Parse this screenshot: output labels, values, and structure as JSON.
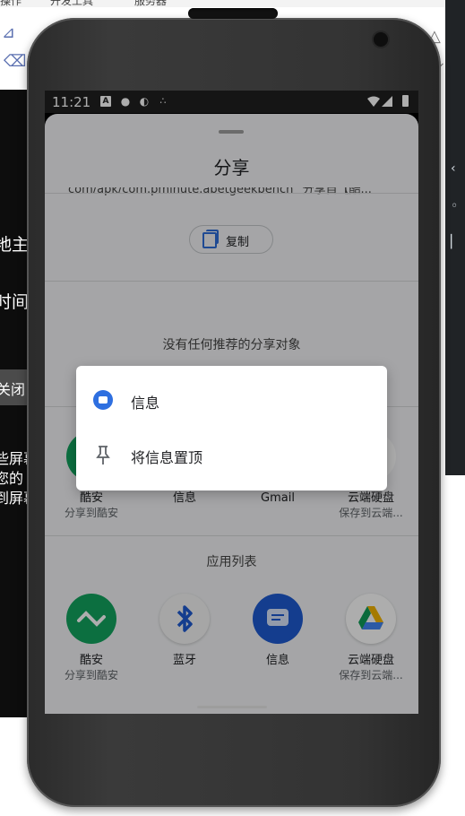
{
  "status_bar": {
    "time": "11:21"
  },
  "sheet": {
    "title": "分享",
    "share_text": "com/apk/com.pminute.abetgeekbench\" 分享自【酷...",
    "copy_label": "复制",
    "no_recommend": "没有任何推荐的分享对象",
    "app_list_title": "应用列表",
    "direct_targets": [
      {
        "name": "酷安",
        "sub": "分享到酷安",
        "icon": "coolapk-icon"
      },
      {
        "name": "信息",
        "sub": "",
        "icon": "messages-icon"
      },
      {
        "name": "Gmail",
        "sub": "",
        "icon": "gmail-icon"
      },
      {
        "name": "云端硬盘",
        "sub": "保存到云端...",
        "icon": "drive-icon"
      }
    ],
    "apps": [
      {
        "name": "酷安",
        "sub": "分享到酷安",
        "icon": "coolapk-icon"
      },
      {
        "name": "蓝牙",
        "sub": "",
        "icon": "bluetooth-icon"
      },
      {
        "name": "信息",
        "sub": "",
        "icon": "messages-icon"
      },
      {
        "name": "云端硬盘",
        "sub": "保存到云端...",
        "icon": "drive-icon"
      }
    ]
  },
  "context_menu": {
    "items": [
      {
        "label": "信息",
        "icon": "messages-icon"
      },
      {
        "label": "将信息置顶",
        "icon": "pin-icon"
      }
    ]
  },
  "background": {
    "top_menu": [
      "操作",
      "开发工具",
      "服务器"
    ],
    "left_texts": [
      "·",
      "地主",
      "时间",
      "关闭",
      "些屏幕",
      "您的",
      "到屏幕"
    ]
  },
  "colors": {
    "accent": "#2f6ed9",
    "coolapk": "#12a45f",
    "messages": "#1e5bd1",
    "sheet_bg": "#f3f4f6"
  }
}
